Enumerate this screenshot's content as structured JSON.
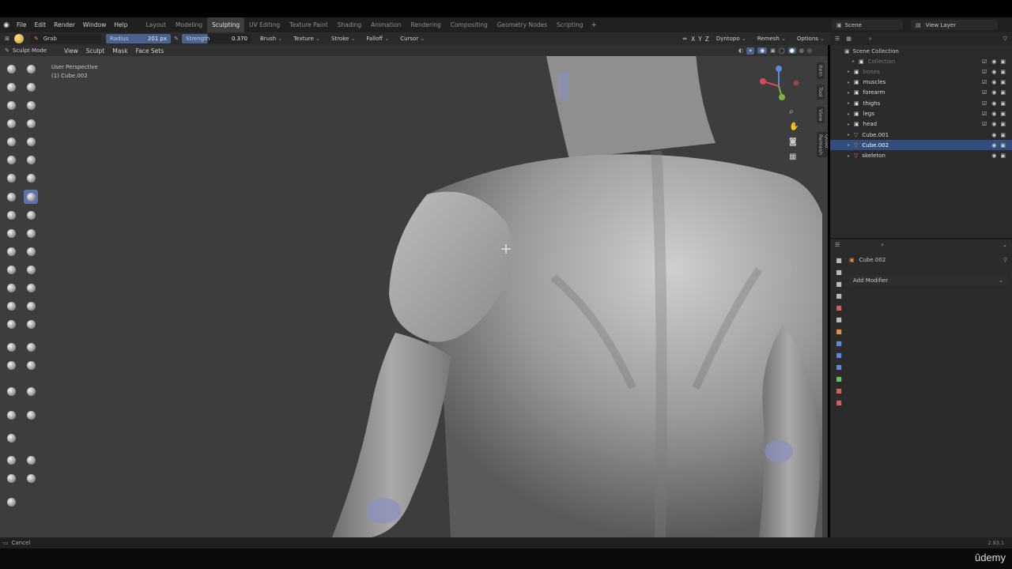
{
  "topbar": {
    "menu": [
      "File",
      "Edit",
      "Render",
      "Window",
      "Help"
    ],
    "workspaces": [
      "Layout",
      "Modeling",
      "Sculpting",
      "UV Editing",
      "Texture Paint",
      "Shading",
      "Animation",
      "Rendering",
      "Compositing",
      "Geometry Nodes",
      "Scripting"
    ],
    "active_workspace": "Sculpting",
    "scene": "Scene",
    "view_layer": "View Layer"
  },
  "tool_settings": {
    "brush_name": "Grab",
    "radius_label": "Radius",
    "radius_value": "201 px",
    "strength_label": "Strength",
    "strength_value": "0.370",
    "menus": [
      "Brush",
      "Texture",
      "Stroke",
      "Falloff",
      "Cursor"
    ],
    "right": [
      "X",
      "Y",
      "Z",
      "Dyntopo",
      "Remesh",
      "Options"
    ]
  },
  "header": {
    "mode": "Sculpt Mode",
    "menus": [
      "View",
      "Sculpt",
      "Mask",
      "Face Sets"
    ]
  },
  "viewport": {
    "perspective": "User Perspective",
    "object": "(1) Cube.002",
    "side_tabs": [
      "Item",
      "Tool",
      "View",
      "Quad Remesh"
    ]
  },
  "outliner": {
    "root": "Scene Collection",
    "items": [
      {
        "label": "Collection",
        "dim": true
      },
      {
        "label": "bones",
        "dim": true
      },
      {
        "label": "muscles"
      },
      {
        "label": "forearm"
      },
      {
        "label": "thighs"
      },
      {
        "label": "legs"
      },
      {
        "label": "head"
      },
      {
        "label": "Cube.001"
      },
      {
        "label": "Cube.002",
        "selected": true
      },
      {
        "label": "skeleton"
      }
    ]
  },
  "properties": {
    "object_name": "Cube.002",
    "add_modifier": "Add Modifier"
  },
  "status": {
    "left": "Cancel",
    "version": "2.93.1"
  },
  "watermark": "ûdemy",
  "colors": {
    "accent": "#5b73a6",
    "selection": "#334d80",
    "viewport_bg": "#3d3d3d"
  }
}
